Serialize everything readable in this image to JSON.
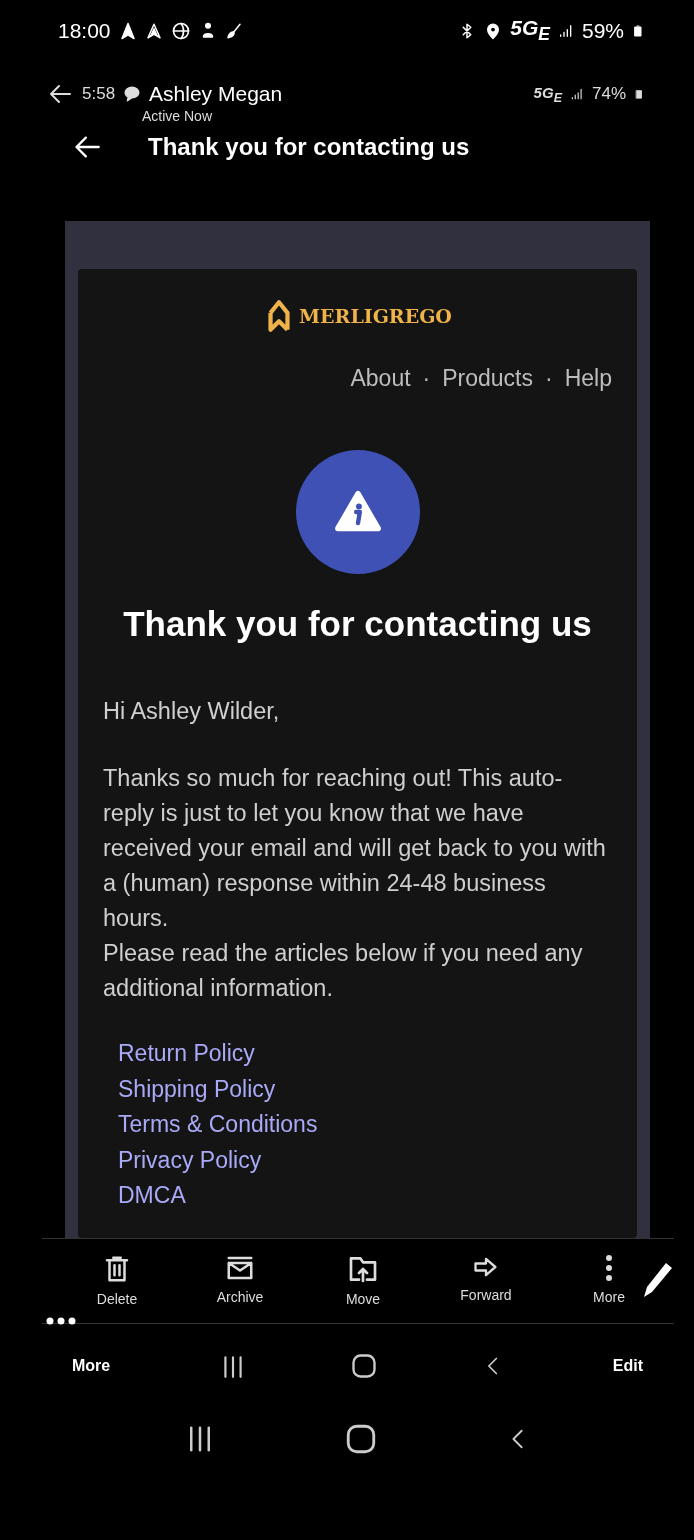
{
  "status_bar": {
    "time": "18:00",
    "network": "5G$_{E}$",
    "battery": "59%"
  },
  "inner_status": {
    "time": "5:58",
    "contact": "Ashley Megan",
    "presence": "Active Now",
    "network": "5G$_{E}$",
    "battery": "74%"
  },
  "app_bar": {
    "title": "Thank you for contacting us"
  },
  "email": {
    "brand": "MERLIGREGO",
    "nav": [
      "About",
      "Products",
      "Help"
    ],
    "nav_separator": "·",
    "heading": "Thank you for contacting us",
    "greeting": "Hi Ashley Wilder,",
    "paragraphs": [
      "Thanks so much for reaching out! This auto-reply is just to let you know that we have received your email and will get back to you with a (human) response within 24-48 business hours.",
      "Please read the articles below if you need any additional information."
    ],
    "links": [
      "Return Policy",
      "Shipping Policy",
      "Terms & Conditions",
      "Privacy Policy",
      "DMCA"
    ]
  },
  "toolbar": [
    {
      "kind": "delete",
      "label": "Delete"
    },
    {
      "kind": "archive",
      "label": "Archive"
    },
    {
      "kind": "move",
      "label": "Move"
    },
    {
      "kind": "forward",
      "label": "Forward"
    },
    {
      "kind": "more",
      "label": "More"
    }
  ],
  "inner_nav": {
    "left": "More",
    "right": "Edit"
  }
}
